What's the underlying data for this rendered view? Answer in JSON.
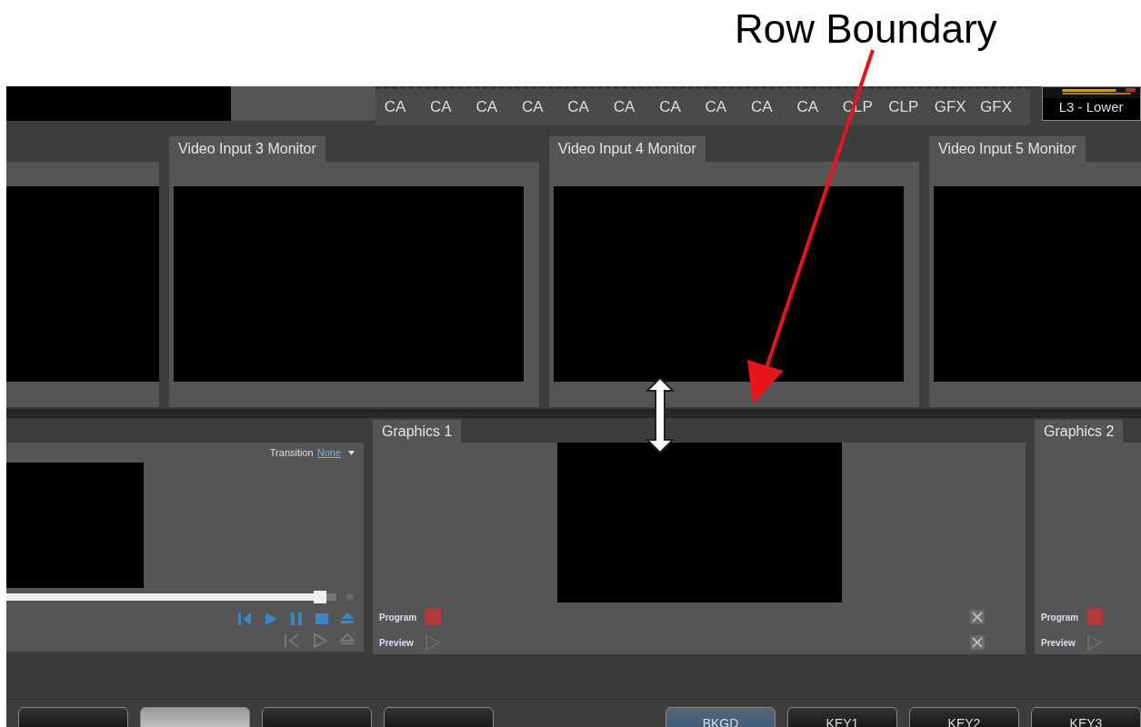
{
  "annotation": {
    "label": "Row Boundary"
  },
  "switcher": {
    "buttons": [
      "CA",
      "CA",
      "CA",
      "CA",
      "CA",
      "CA",
      "CA",
      "CA",
      "CA",
      "CA",
      "CLP",
      "CLP",
      "GFX",
      "GFX"
    ],
    "thumbnail_label": "L3 - Lower"
  },
  "monitor_row": [
    {
      "title": "Video Input 3 Monitor"
    },
    {
      "title": "Video Input 4 Monitor"
    },
    {
      "title": "Video Input 5 Monitor"
    }
  ],
  "media_panel": {
    "transition_label": "Transition",
    "transition_value": "None",
    "level": 0.97
  },
  "graphics_row": [
    {
      "title": "Graphics 1",
      "program_label": "Program",
      "preview_label": "Preview"
    },
    {
      "title": "Graphics 2",
      "program_label": "Program",
      "preview_label": "Preview"
    }
  ],
  "bus_buttons": [
    {
      "selected": false
    },
    {
      "selected": true
    },
    {
      "selected": false
    },
    {
      "selected": false
    }
  ],
  "key_buttons": [
    {
      "label": "BKGD",
      "selected": true
    },
    {
      "label": "KEY1",
      "selected": false
    },
    {
      "label": "KEY2",
      "selected": false
    },
    {
      "label": "KEY3",
      "selected": false
    }
  ]
}
